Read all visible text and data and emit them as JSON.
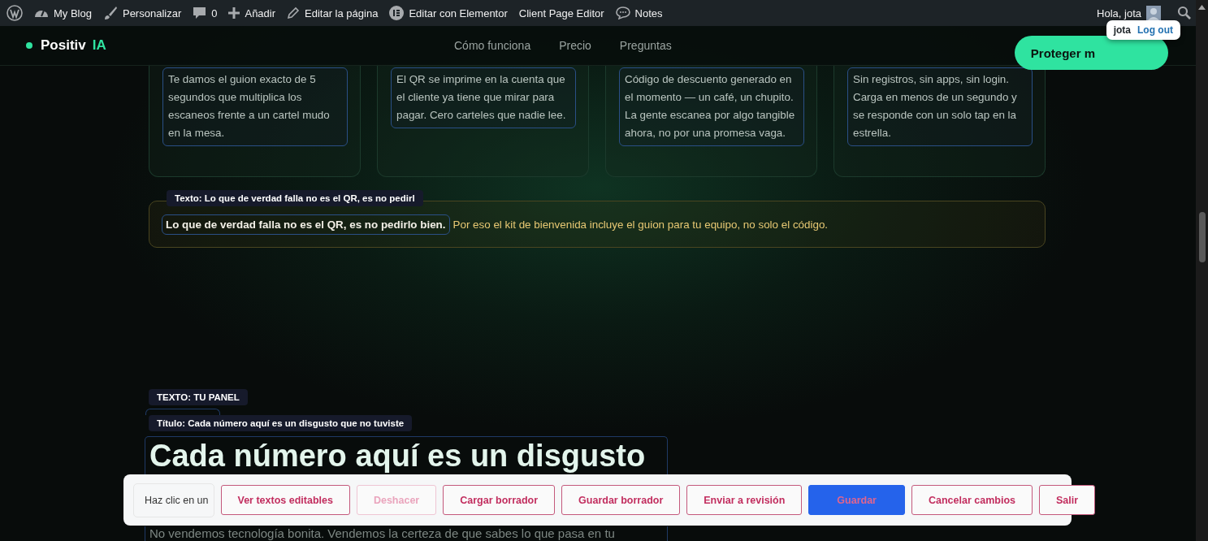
{
  "admin_bar": {
    "items": [
      "My Blog",
      "Personalizar",
      "0",
      "Añadir",
      "Editar la página",
      "Editar con Elementor",
      "Client Page Editor",
      "Notes"
    ],
    "greeting": "Hola, jota",
    "user_popup": {
      "name": "jota",
      "link": "Log out"
    }
  },
  "header": {
    "logo": "Positiv",
    "logo_accent": "IA",
    "nav": [
      "Cómo funciona",
      "Precio",
      "Preguntas"
    ],
    "cta": "Proteger m"
  },
  "cards": [
    {
      "text": "Te damos el guion exacto de 5 segundos que multiplica los escaneos frente a un cartel mudo en la mesa."
    },
    {
      "text": "El QR se imprime en la cuenta que el cliente ya tiene que mirar para pagar. Cero carteles que nadie lee."
    },
    {
      "text": "Código de descuento generado en el momento — un café, un chupito. La gente escanea por algo tangible ahora, no por una promesa vaga."
    },
    {
      "text": "Sin registros, sin apps, sin login. Carga en menos de un segundo y se responde con un solo tap en la estrella."
    }
  ],
  "tip": {
    "tag": "Texto: Lo que de verdad falla no es el QR, es no pedirl",
    "bold": "Lo que de verdad falla no es el QR, es no pedirlo bien.",
    "rest": "Por eso el kit de bienvenida incluye el guion para tu equipo, no solo el código."
  },
  "panel": {
    "eyebrow_tag": "TEXTO: TU PANEL",
    "title_tag": "Título: Cada número aquí es un disgusto que no tuviste",
    "title": "Cada número aquí es un disgusto",
    "paragraph": "No vendemos tecnología bonita. Vendemos la certeza de que sabes lo que pasa en tu"
  },
  "toolbar": {
    "status": "Haz clic en un",
    "buttons": [
      {
        "label": "Ver textos editables",
        "kind": "outline",
        "disabled": false
      },
      {
        "label": "Deshacer",
        "kind": "outline",
        "disabled": true
      },
      {
        "label": "Cargar borrador",
        "kind": "outline",
        "disabled": false
      },
      {
        "label": "Guardar borrador",
        "kind": "outline",
        "disabled": false
      },
      {
        "label": "Enviar a revisión",
        "kind": "outline",
        "disabled": false
      },
      {
        "label": "Guardar",
        "kind": "primary",
        "disabled": false
      },
      {
        "label": "Cancelar cambios",
        "kind": "outline",
        "disabled": false
      },
      {
        "label": "Salir",
        "kind": "outline",
        "disabled": false
      }
    ]
  }
}
